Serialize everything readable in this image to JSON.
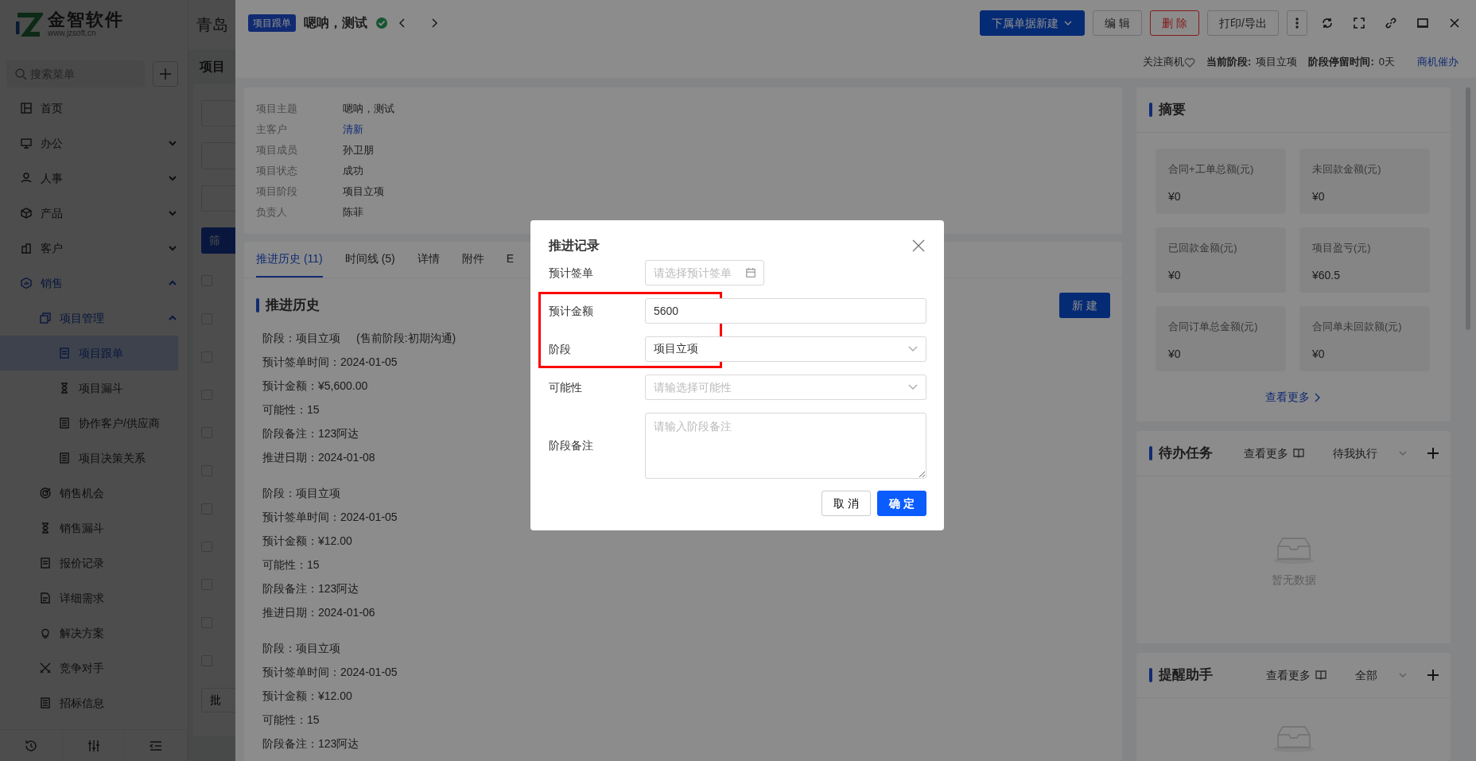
{
  "sidebar": {
    "logo": {
      "name": "金智软件",
      "url": "www.jzsoft.cn"
    },
    "search": {
      "placeholder": "搜索菜单"
    },
    "items": [
      {
        "label": "首页",
        "selected": false
      },
      {
        "label": "办公",
        "selected": false,
        "expanded": false
      },
      {
        "label": "人事",
        "selected": false,
        "expanded": false
      },
      {
        "label": "产品",
        "selected": false,
        "expanded": false
      },
      {
        "label": "客户",
        "selected": false,
        "expanded": false
      },
      {
        "label": "销售",
        "selected": false,
        "expanded": true,
        "children": [
          {
            "label": "项目管理",
            "selected": false,
            "expanded": true,
            "children": [
              {
                "label": "项目跟单",
                "selected": true
              },
              {
                "label": "项目漏斗",
                "selected": false
              },
              {
                "label": "协作客户/供应商",
                "selected": false
              },
              {
                "label": "项目决策关系",
                "selected": false
              }
            ]
          },
          {
            "label": "销售机会",
            "selected": false
          },
          {
            "label": "销售漏斗",
            "selected": false
          },
          {
            "label": "报价记录",
            "selected": false
          },
          {
            "label": "详细需求",
            "selected": false
          },
          {
            "label": "解决方案",
            "selected": false
          },
          {
            "label": "竞争对手",
            "selected": false
          },
          {
            "label": "招标信息",
            "selected": false
          }
        ]
      }
    ]
  },
  "background_page": {
    "company": "青岛",
    "title": "项目",
    "filter_button": "筛",
    "batch_button": "批",
    "rows": [
      {
        "checked": false
      },
      {
        "checked": false
      },
      {
        "checked": false
      },
      {
        "checked": false
      },
      {
        "checked": false
      },
      {
        "checked": false
      },
      {
        "checked": false
      },
      {
        "checked": false
      },
      {
        "checked": false
      },
      {
        "checked": false
      },
      {
        "checked": false
      }
    ]
  },
  "record": {
    "tag": "项目跟单",
    "title": "嗯呐，测试",
    "verified": true
  },
  "actions": [
    {
      "label": "下属单据新建",
      "kind": "primary-dropdown"
    },
    {
      "label": "编 辑",
      "kind": "default"
    },
    {
      "label": "删 除",
      "kind": "danger"
    },
    {
      "label": "打印/导出",
      "kind": "default"
    }
  ],
  "status_line": {
    "follow": "关注商机",
    "stage_label": "当前阶段:",
    "stage": "项目立项",
    "dwell_label": "阶段停留时间:",
    "dwell": "0天",
    "urge": "商机催办"
  },
  "info": [
    {
      "label": "项目主题",
      "value": "嗯呐，测试",
      "link": false
    },
    {
      "label": "主客户",
      "value": "清新",
      "link": true
    },
    {
      "label": "项目成员",
      "value": "孙卫朋",
      "link": false
    },
    {
      "label": "项目状态",
      "value": "成功",
      "link": false
    },
    {
      "label": "项目阶段",
      "value": "项目立项",
      "link": false
    },
    {
      "label": "负责人",
      "value": "陈菲",
      "link": false
    }
  ],
  "tabs": [
    {
      "label": "推进历史 (11)",
      "selected": true
    },
    {
      "label": "时间线 (5)",
      "selected": false
    },
    {
      "label": "详情",
      "selected": false
    },
    {
      "label": "附件",
      "selected": false
    },
    {
      "label": "E",
      "selected": false
    }
  ],
  "history": {
    "title": "推进历史",
    "new_button": "新 建",
    "entries": [
      {
        "lines": [
          "阶段：项目立项",
          "预计签单时间：2024-01-05",
          "预计金额：¥5,600.00",
          "可能性：15",
          "阶段备注：123阿达",
          "推进日期：2024-01-08"
        ],
        "extra": "(售前阶段:初期沟通)"
      },
      {
        "lines": [
          "阶段：项目立项",
          "预计签单时间：2024-01-05",
          "预计金额：¥12.00",
          "可能性：15",
          "阶段备注：123阿达",
          "推进日期：2024-01-06"
        ]
      },
      {
        "lines": [
          "阶段：项目立项",
          "预计签单时间：2024-01-05",
          "预计金额：¥12.00",
          "可能性：15",
          "阶段备注：123阿达"
        ]
      }
    ]
  },
  "summary": {
    "title": "摘要",
    "tiles": [
      {
        "label": "合同+工单总额(元)",
        "value": "¥0"
      },
      {
        "label": "未回款金额(元)",
        "value": "¥0"
      },
      {
        "label": "已回款金额(元)",
        "value": "¥0"
      },
      {
        "label": "项目盈亏(元)",
        "value": "¥60.5"
      },
      {
        "label": "合同订单总金额(元)",
        "value": "¥0"
      },
      {
        "label": "合同单未回款额(元)",
        "value": "¥0"
      }
    ],
    "more": "查看更多"
  },
  "tasks": {
    "title": "待办任务",
    "more": "查看更多",
    "filter": "待我执行",
    "empty": "暂无数据"
  },
  "reminders": {
    "title": "提醒助手",
    "more": "查看更多",
    "filter": "全部"
  },
  "modal": {
    "title": "推进记录",
    "fields": [
      {
        "label": "预计签单",
        "kind": "date",
        "placeholder": "请选择预计签单",
        "highlighted": false
      },
      {
        "label": "预计金额",
        "kind": "text",
        "value": "5600",
        "highlighted": true
      },
      {
        "label": "阶段",
        "kind": "select",
        "value": "项目立项",
        "highlighted": true
      },
      {
        "label": "可能性",
        "kind": "select",
        "placeholder": "请输选择可能性",
        "highlighted": false
      },
      {
        "label": "阶段备注",
        "kind": "textarea",
        "placeholder": "请输入阶段备注",
        "highlighted": false
      }
    ],
    "buttons": [
      {
        "label": "取 消",
        "kind": "default"
      },
      {
        "label": "确 定",
        "kind": "primary"
      }
    ]
  }
}
